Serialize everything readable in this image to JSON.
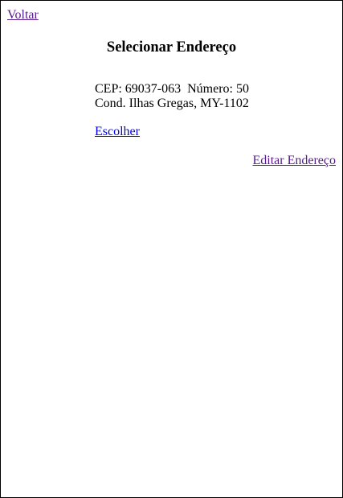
{
  "nav": {
    "back_label": "Voltar"
  },
  "page": {
    "title": "Selecionar Endereço"
  },
  "address": {
    "cep_label": "CEP:",
    "cep_value": "69037-063",
    "number_label": "Número:",
    "number_value": "50",
    "street": "Cond. Ilhas Gregas, MY-1102"
  },
  "actions": {
    "choose_label": "Escolher",
    "edit_label": "Editar Endereço"
  },
  "colors": {
    "link_unvisited": "#0000ee",
    "link_visited": "#551a8b"
  }
}
